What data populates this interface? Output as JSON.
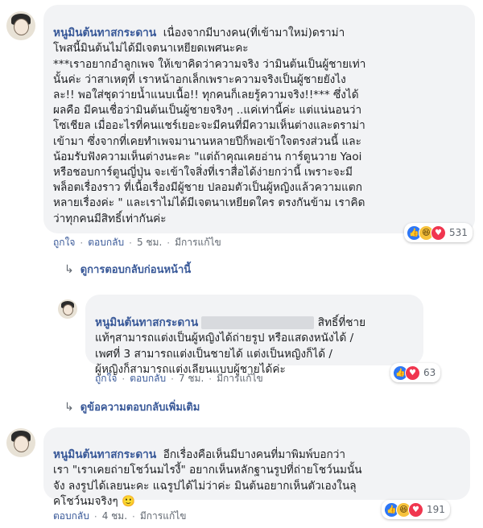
{
  "comment1": {
    "author": "หนูมินต้นทาสกระดาน",
    "body": "เนื่องจากมีบางคน(ที่เข้ามาใหม่)ดราม่า\nโพสนี้มินต้นไม่ได้มีเจตนาเหยียดเพศนะคะ\n***เราอยากอำลูกเพจ ให้เขาคิดว่าความจริง ว่ามินต้นเป็นผู้ชายเท่า\nนั้นค่ะ ว่าสาเหตุที่ เราหน้าอกเล็กเพราะความจริงเป็นผู้ชายยังไง\nละ!! พอใส่ชุดว่ายน้ำแนบเนื้อ!! ทุกคนก็เลยรู้ความจริง!!*** ซึ่งได้\nผลคือ มีคนเชื่อว่ามินต้นเป็นผู้ชายจริงๆ ..แค่เท่านี้ค่ะ แต่แน่นอนว่า\nโซเชียล เมื่ออะไรที่คนแชร์เยอะจะมีคนที่มีความเห็นต่างและดราม่า\nเข้ามา ซึ่งจากที่เคยทำเพจมานานหลายปีก็พอเข้าใจตรงส่วนนี้ และ\nน้อมรับฟังความเห็นต่างนะคะ \"แต่ถ้าคุณเคยอ่าน การ์ตูนวาย Yaoi\nหรือชอบการ์ตูนญี่ปุ่น จะเข้าใจสิ่งที่เราสื่อได้ง่ายกว่านี้ เพราะจะมี\nพล็อตเรื่องราว ที่เนื้อเรื่องมีผู้ชาย ปลอมตัวเป็นผู้หญิงแล้วความแตก\nหลายเรื่องค่ะ \" และเราไม่ได้มีเจตนาเหยียดใคร ตรงกันข้าม เราคิด\nว่าทุกคนมีสิทธิ์เท่ากันค่ะ",
    "like": "ถูกใจ",
    "reply": "ตอบกลับ",
    "time": "5 ชม.",
    "edited": "มีการแก้ไข",
    "reaction_count": "531"
  },
  "view_previous": "ดูการตอบกลับก่อนหน้านี้",
  "reply1": {
    "author": "หนูมินต้นทาสกระดาน",
    "first_line_tail": "สิทธิ์ที่ชาย",
    "body": "แท้ๆสามารถแต่งเป็นผู้หญิงได้ถ่ายรูป หรือแสดงหนังได้ /\nเพศที่ 3 สามารถแต่งเป็นชายได้ แต่งเป็นหญิงก็ได้ /\nผู้หญิงก็สามารถแต่งเลียนแบบผู้ชายได้ค่ะ",
    "like": "ถูกใจ",
    "reply": "ตอบกลับ",
    "time": "7 ชม.",
    "edited": "มีการแก้ไข",
    "reaction_count": "63"
  },
  "view_more": "ดูข้อความตอบกลับเพิ่มเติม",
  "comment2": {
    "author": "หนูมินต้นทาสกระดาน",
    "body": "อีกเรื่องคือเห็นมีบางคนที่มาพิมพ์บอกว่า\nเรา \"เราเคยถ่ายโชว์นมไรงี้\" อยากเห็นหลักฐานรูปที่ถ่ายโชว์นมนั้น\nจัง ลงรูปได้เลยนะคะ แฉรูปได้ไม่ว่าค่ะ มินต้นอยากเห็นตัวเองในลุ\nคโชว์นมจริงๆ 🙂",
    "reply": "ตอบกลับ",
    "time": "4 ชม.",
    "edited": "มีการแก้ไข",
    "reaction_count": "191"
  },
  "colors": {
    "link": "#385898",
    "bubble": "#f2f3f5",
    "meta": "#606770"
  },
  "icons": [
    "like-reaction-icon",
    "haha-reaction-icon",
    "love-reaction-icon",
    "reply-arrow-icon"
  ]
}
